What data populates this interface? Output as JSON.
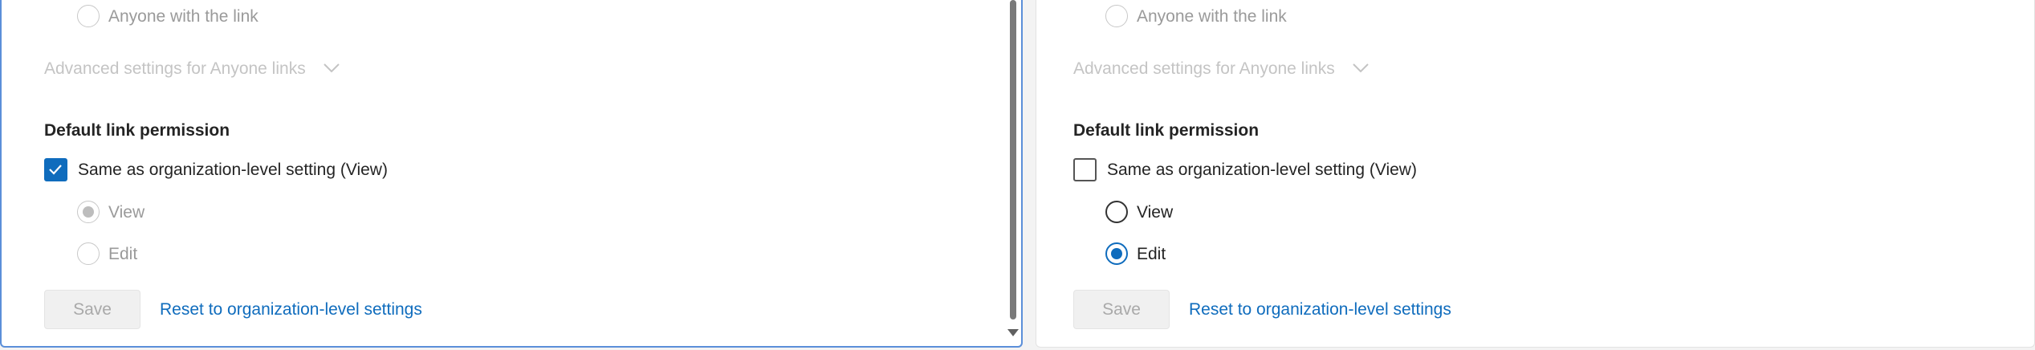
{
  "left_panel": {
    "anyone_option": {
      "label": "Anyone with the link",
      "selected": false,
      "disabled": true
    },
    "advanced_label": "Advanced settings for Anyone links",
    "section_title": "Default link permission",
    "same_as_org": {
      "label": "Same as organization-level setting (View)",
      "checked": true
    },
    "permissions": [
      {
        "label": "View",
        "selected": true,
        "disabled": true
      },
      {
        "label": "Edit",
        "selected": false,
        "disabled": true
      }
    ],
    "save_label": "Save",
    "reset_label": "Reset to organization-level settings"
  },
  "right_panel": {
    "anyone_option": {
      "label": "Anyone with the link",
      "selected": false,
      "disabled": true
    },
    "advanced_label": "Advanced settings for Anyone links",
    "section_title": "Default link permission",
    "same_as_org": {
      "label": "Same as organization-level setting (View)",
      "checked": false
    },
    "permissions": [
      {
        "label": "View",
        "selected": false,
        "disabled": false
      },
      {
        "label": "Edit",
        "selected": true,
        "disabled": false
      }
    ],
    "save_label": "Save",
    "reset_label": "Reset to organization-level settings"
  },
  "colors": {
    "accent": "#0f6cbd",
    "disabled_text": "#9a9a9a",
    "panel_focus_border": "#5b8fd9"
  }
}
